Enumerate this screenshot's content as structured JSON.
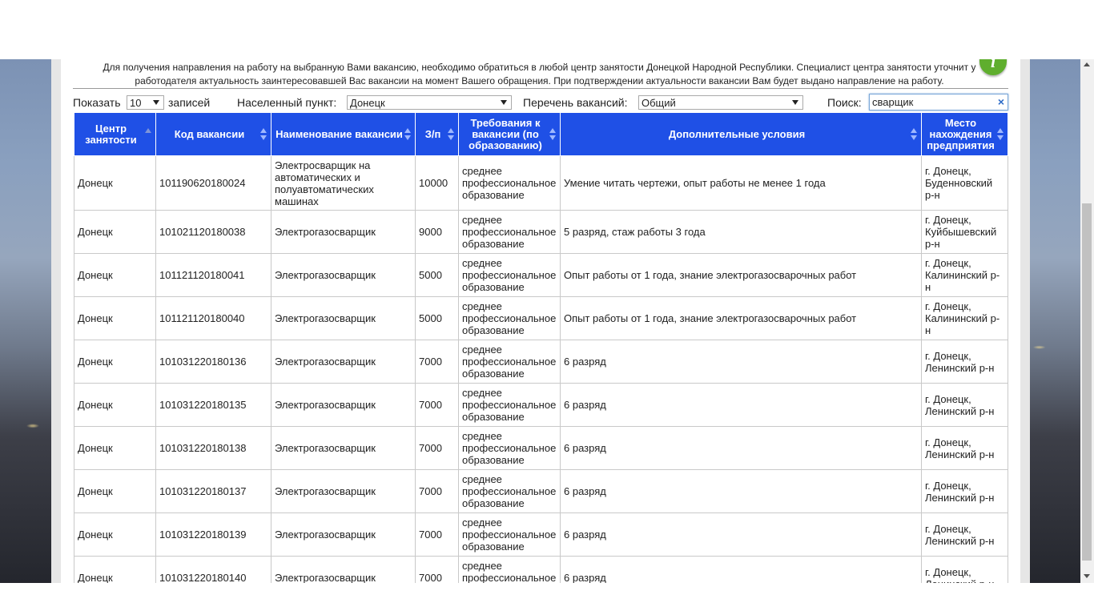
{
  "notice": {
    "text": "Для получения направления на работу на выбранную Вами вакансию, необходимо обратиться в любой центр занятости Донецкой Народной Республики. Специалист центра занятости уточнит у работодателя актуальность заинтересовавшей Вас вакансии на момент Вашего обращения. При подтверждении актуальности вакансии Вам будет выдано направление на работу.",
    "icon": "info-icon",
    "icon_color": "#5fae2e"
  },
  "controls": {
    "show_label": "Показать",
    "page_size": "10",
    "records_label": "записей",
    "locality_label": "Населенный пункт:",
    "locality_value": "Донецк",
    "vacancy_list_label": "Перечень вакансий:",
    "vacancy_list_value": "Общий",
    "search_label": "Поиск:",
    "search_value": "сварщик",
    "search_clear": "×"
  },
  "table": {
    "header_color": "#1f50e6",
    "columns": [
      "Центр занятости",
      "Код вакансии",
      "Наименование вакансии",
      "З/п",
      "Требования к вакансии (по образованию)",
      "Дополнительные условия",
      "Место нахождения предприятия"
    ],
    "rows": [
      [
        "Донецк",
        "101190620180024",
        "Электросварщик на автоматических и полуавтоматических машинах",
        "10000",
        "среднее профессиональное образование",
        "Умение читать чертежи, опыт работы не менее 1 года",
        "г. Донецк, Буденновский р-н"
      ],
      [
        "Донецк",
        "101021120180038",
        "Электрогазосварщик",
        "9000",
        "среднее профессиональное образование",
        "5 разряд, стаж работы 3 года",
        "г. Донецк, Куйбышевский р-н"
      ],
      [
        "Донецк",
        "101121120180041",
        "Электрогазосварщик",
        "5000",
        "среднее профессиональное образование",
        "Опыт работы от 1 года, знание электрогазосварочных работ",
        "г. Донецк, Калининский р-н"
      ],
      [
        "Донецк",
        "101121120180040",
        "Электрогазосварщик",
        "5000",
        "среднее профессиональное образование",
        "Опыт работы от 1 года, знание электрогазосварочных работ",
        "г. Донецк, Калининский р-н"
      ],
      [
        "Донецк",
        "101031220180136",
        "Электрогазосварщик",
        "7000",
        "среднее профессиональное образование",
        "6 разряд",
        "г. Донецк, Ленинский р-н"
      ],
      [
        "Донецк",
        "101031220180135",
        "Электрогазосварщик",
        "7000",
        "среднее профессиональное образование",
        "6 разряд",
        "г. Донецк, Ленинский р-н"
      ],
      [
        "Донецк",
        "101031220180138",
        "Электрогазосварщик",
        "7000",
        "среднее профессиональное образование",
        "6 разряд",
        "г. Донецк, Ленинский р-н"
      ],
      [
        "Донецк",
        "101031220180137",
        "Электрогазосварщик",
        "7000",
        "среднее профессиональное образование",
        "6 разряд",
        "г. Донецк, Ленинский р-н"
      ],
      [
        "Донецк",
        "101031220180139",
        "Электрогазосварщик",
        "7000",
        "среднее профессиональное образование",
        "6 разряд",
        "г. Донецк, Ленинский р-н"
      ],
      [
        "Донецк",
        "101031220180140",
        "Электрогазосварщик",
        "7000",
        "среднее профессиональное образование",
        "6 разряд",
        "г. Донецк, Ленинский р-н"
      ]
    ]
  }
}
